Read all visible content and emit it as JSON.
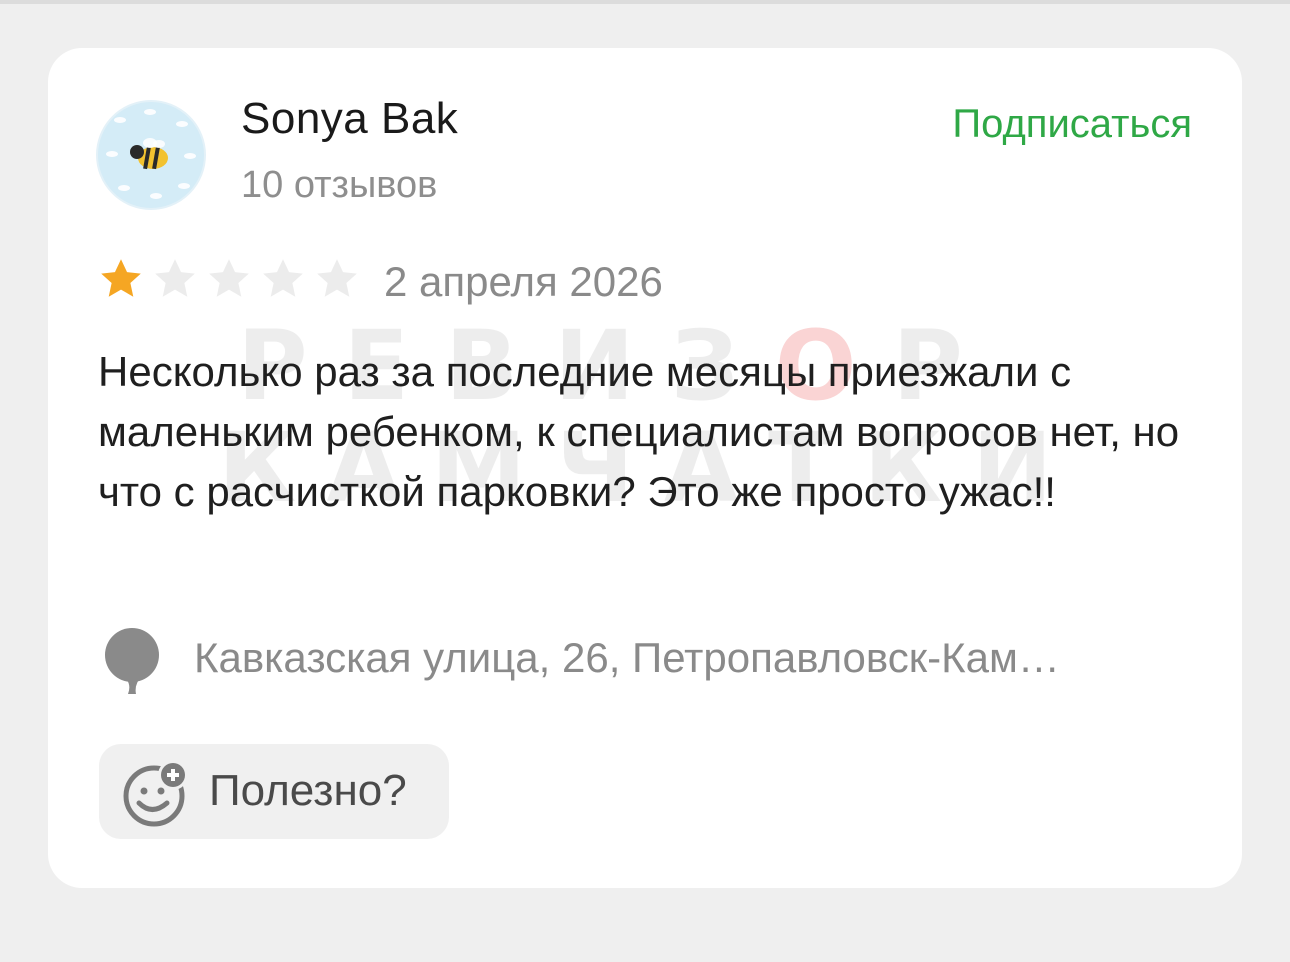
{
  "review": {
    "author_name": "Sonya Bak",
    "review_count": "10 отзывов",
    "subscribe_label": "Подписаться",
    "rating": 1,
    "max_rating": 5,
    "date": "2 апреля 2026",
    "text": "Несколько раз за последние месяцы приезжали с маленьким ребенком, к специалистам вопросов нет, но что с расчисткой парковки? Это же просто ужас!!",
    "address": "Кавказская улица, 26, Петропавловск-Кам…",
    "useful_label": "Полезно?"
  },
  "watermark": {
    "line1_prefix": "РЕВИЗ",
    "line1_o": "О",
    "line1_suffix": "Р",
    "line2": "КАМЧАТКИ"
  },
  "colors": {
    "accent_green": "#2fa846",
    "star_filled": "#f5a623",
    "star_empty": "#ececec",
    "muted_text": "#8a8a8a"
  },
  "icons": {
    "avatar": "bee-avatar",
    "location": "map-pin-icon",
    "useful": "smile-plus-icon"
  }
}
